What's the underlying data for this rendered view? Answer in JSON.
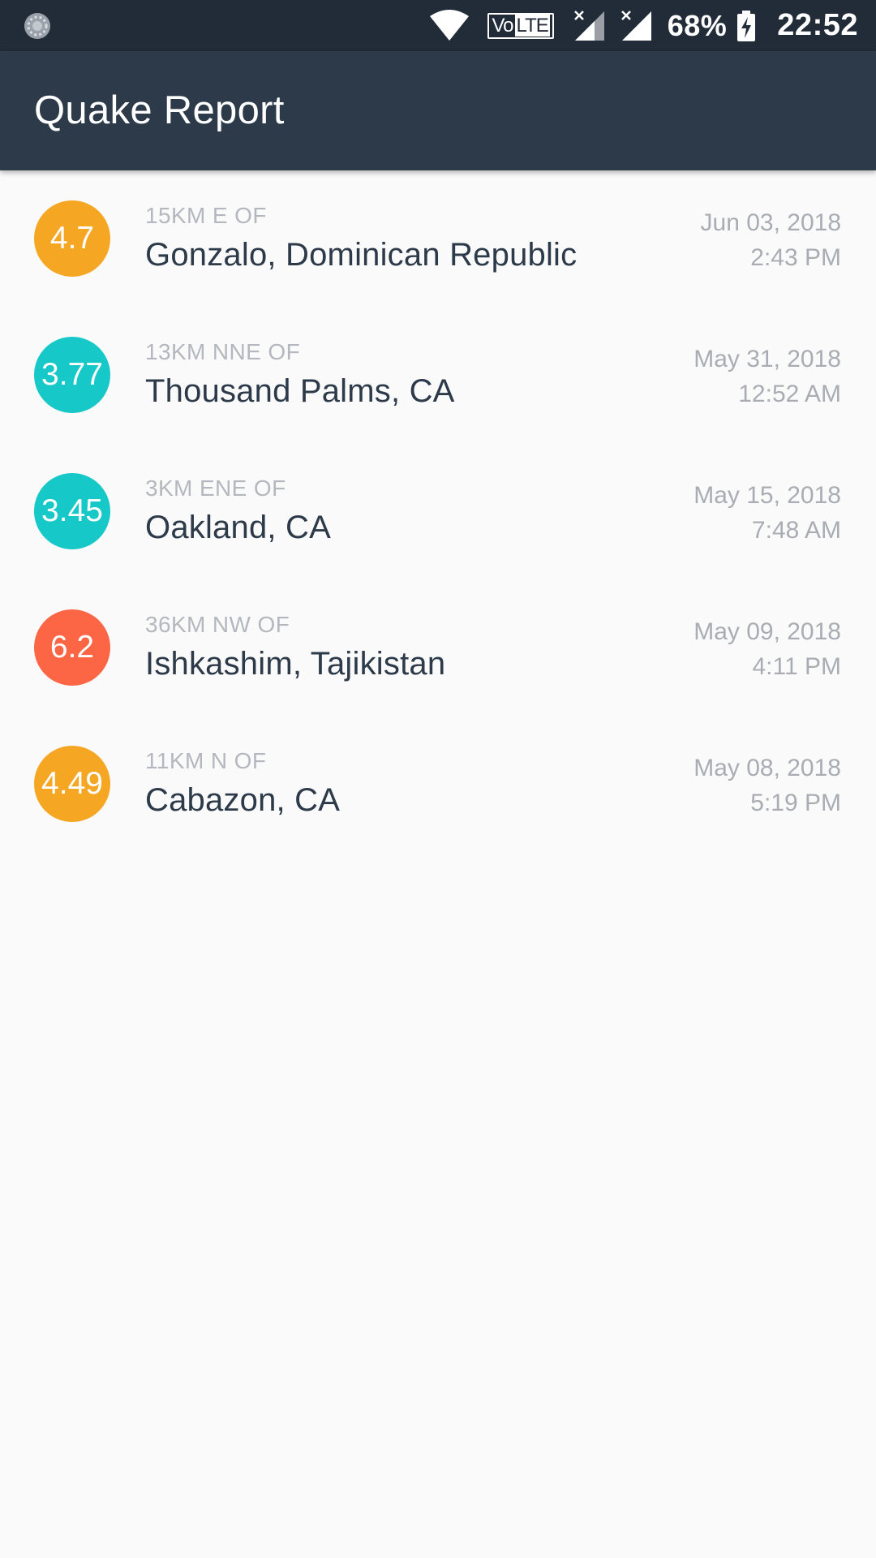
{
  "status_bar": {
    "left_icon": "sync-spinner-icon",
    "icons": [
      "wifi-icon",
      "volte-icon",
      "signal-x-icon",
      "signal-x-icon",
      "battery-charging-icon"
    ],
    "volte_label_vo": "Vo",
    "volte_label_lte": "LTE",
    "battery_percent": "68%",
    "clock": "22:52"
  },
  "app_bar": {
    "title": "Quake Report"
  },
  "colors": {
    "app_bar": "#2c3a4a",
    "status_bar": "#222c38",
    "background": "#fafafa",
    "mag_orange": "#f5a623",
    "mag_teal": "#16c8c8",
    "mag_red": "#fc6644",
    "primary_text": "#2c3a4a",
    "secondary_text": "#b4b8be"
  },
  "earthquakes": [
    {
      "magnitude": "4.7",
      "color": "#f5a623",
      "offset": "15KM E OF",
      "place": "Gonzalo, Dominican Republic",
      "date": "Jun 03, 2018",
      "time": "2:43 PM"
    },
    {
      "magnitude": "3.77",
      "color": "#16c8c8",
      "offset": "13KM NNE OF",
      "place": "Thousand Palms, CA",
      "date": "May 31, 2018",
      "time": "12:52 AM"
    },
    {
      "magnitude": "3.45",
      "color": "#16c8c8",
      "offset": "3KM ENE OF",
      "place": "Oakland, CA",
      "date": "May 15, 2018",
      "time": "7:48 AM"
    },
    {
      "magnitude": "6.2",
      "color": "#fc6644",
      "offset": "36KM NW OF",
      "place": "Ishkashim, Tajikistan",
      "date": "May 09, 2018",
      "time": "4:11 PM"
    },
    {
      "magnitude": "4.49",
      "color": "#f5a623",
      "offset": "11KM N OF",
      "place": "Cabazon, CA",
      "date": "May 08, 2018",
      "time": "5:19 PM"
    }
  ]
}
